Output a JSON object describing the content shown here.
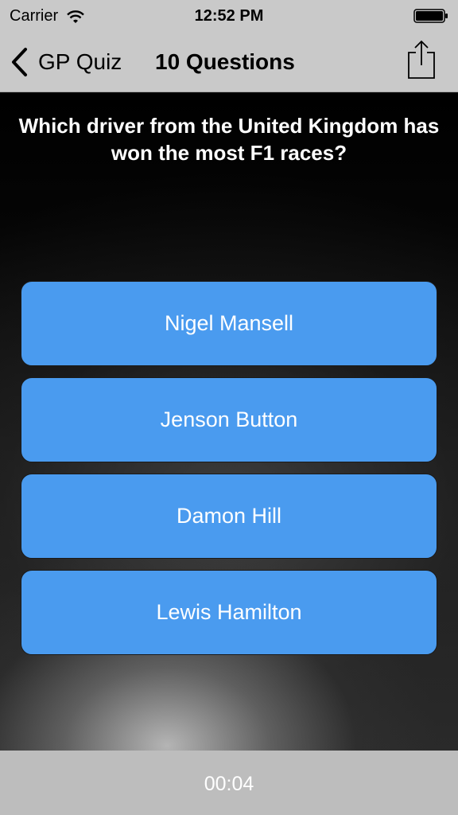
{
  "status_bar": {
    "carrier": "Carrier",
    "time": "12:52 PM",
    "icons": [
      "wifi-icon",
      "battery-icon"
    ]
  },
  "nav": {
    "back_label": "GP Quiz",
    "title": "10 Questions",
    "icons": [
      "chevron-left-icon",
      "share-icon"
    ]
  },
  "quiz": {
    "question": "Which driver from the United Kingdom has won the most F1 races?",
    "answers": [
      "Nigel Mansell",
      "Jenson Button",
      "Damon Hill",
      "Lewis Hamilton"
    ]
  },
  "footer": {
    "timer": "00:04"
  },
  "colors": {
    "bar_bg": "#c9c9c9",
    "answer_bg": "#4a9bef",
    "footer_bg": "#bdbdbd"
  }
}
